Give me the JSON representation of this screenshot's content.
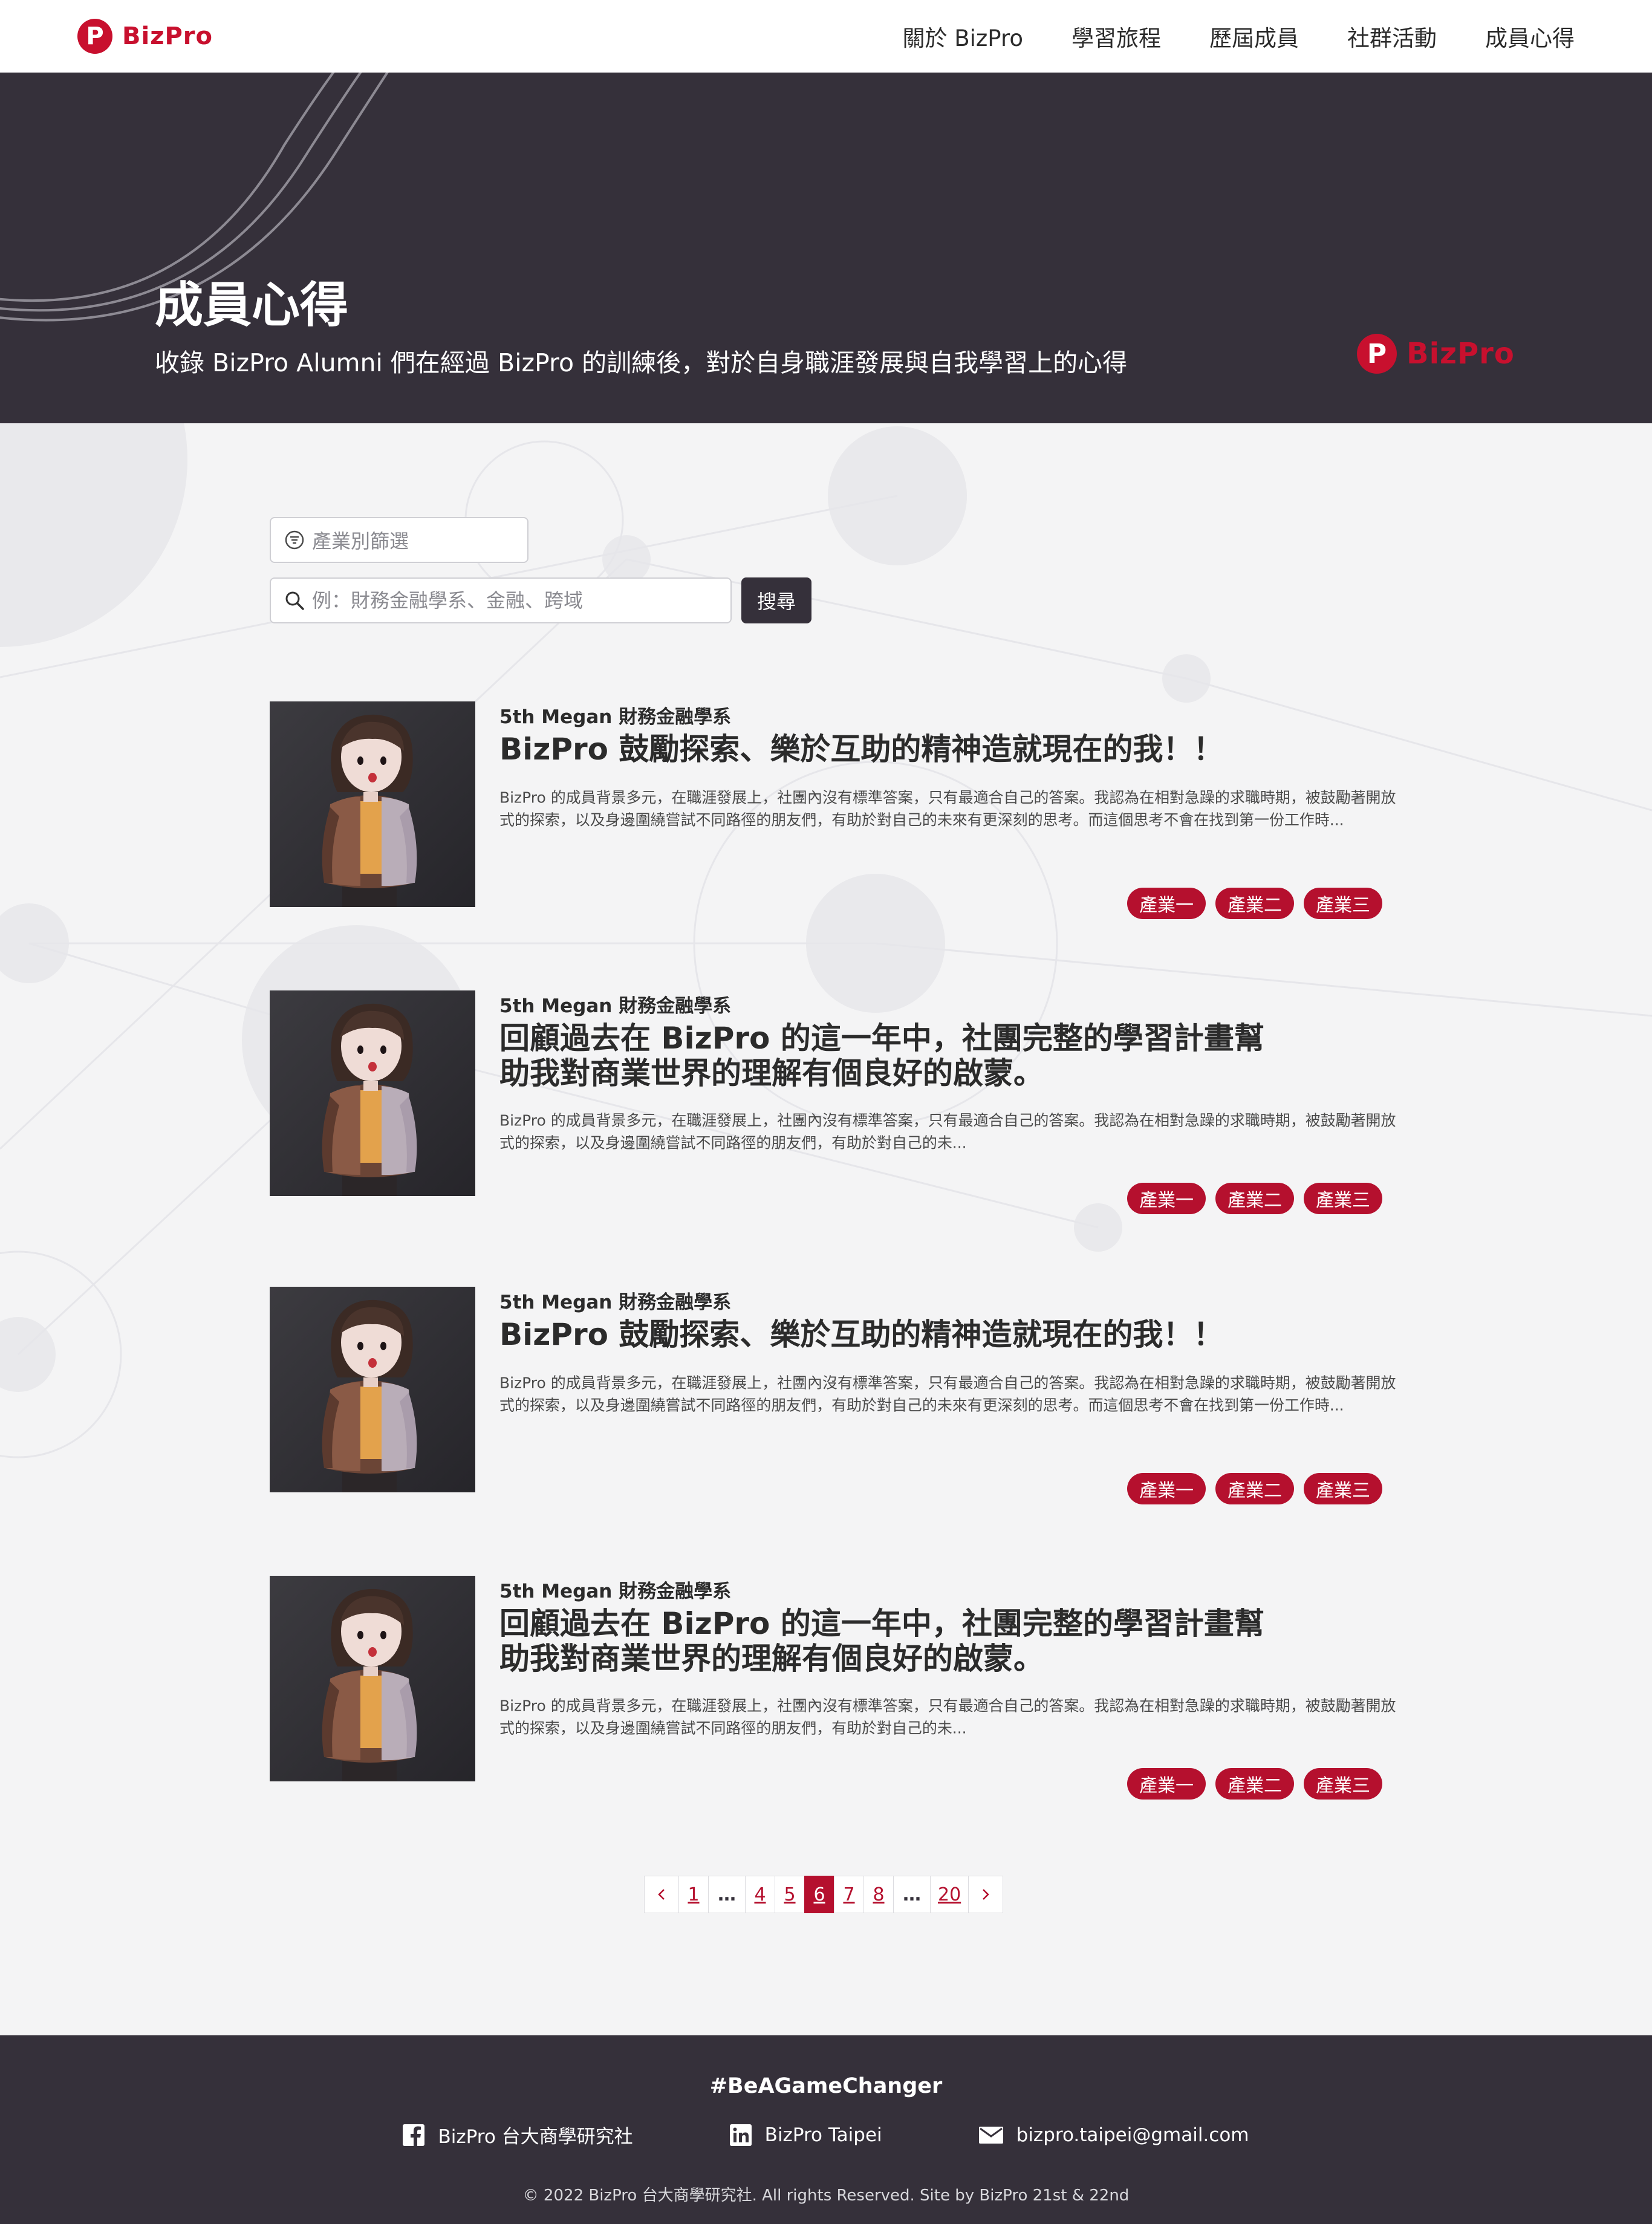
{
  "header": {
    "logo_letter": "P",
    "logo_text": "BizPro",
    "nav": [
      {
        "label": "關於 BizPro"
      },
      {
        "label": "學習旅程"
      },
      {
        "label": "歷屆成員"
      },
      {
        "label": "社群活動"
      },
      {
        "label": "成員心得"
      }
    ]
  },
  "hero": {
    "title": "成員心得",
    "subtitle": "收錄 BizPro Alumni 們在經過 BizPro 的訓練後，對於自身職涯發展與自我學習上的心得",
    "logo_letter": "P",
    "logo_text": "BizPro"
  },
  "filters": {
    "industry_placeholder": "產業別篩選",
    "search_placeholder": "例：財務金融學系、金融、跨域",
    "search_value": "",
    "search_button": "搜尋"
  },
  "articles": [
    {
      "meta": "5th Megan 財務金融學系",
      "title": "BizPro 鼓勵探索、樂於互助的精神造就現在的我！！",
      "excerpt": "BizPro 的成員背景多元，在職涯發展上，社團內沒有標準答案，只有最適合自己的答案。我認為在相對急躁的求職時期，被鼓勵著開放式的探索，以及身邊圍繞嘗試不同路徑的朋友們，有助於對自己的未來有更深刻的思考。而這個思考不會在找到第一份工作時...",
      "tags": [
        "產業一",
        "產業二",
        "產業三"
      ]
    },
    {
      "meta": "5th Megan 財務金融學系",
      "title": "回顧過去在 BizPro 的這一年中，社團完整的學習計畫幫助我對商業世界的理解有個良好的啟蒙。",
      "excerpt": "BizPro 的成員背景多元，在職涯發展上，社團內沒有標準答案，只有最適合自己的答案。我認為在相對急躁的求職時期，被鼓勵著開放式的探索，以及身邊圍繞嘗試不同路徑的朋友們，有助於對自己的未...",
      "tags": [
        "產業一",
        "產業二",
        "產業三"
      ]
    },
    {
      "meta": "5th Megan 財務金融學系",
      "title": "BizPro 鼓勵探索、樂於互助的精神造就現在的我！！",
      "excerpt": "BizPro 的成員背景多元，在職涯發展上，社團內沒有標準答案，只有最適合自己的答案。我認為在相對急躁的求職時期，被鼓勵著開放式的探索，以及身邊圍繞嘗試不同路徑的朋友們，有助於對自己的未來有更深刻的思考。而這個思考不會在找到第一份工作時...",
      "tags": [
        "產業一",
        "產業二",
        "產業三"
      ]
    },
    {
      "meta": "5th Megan 財務金融學系",
      "title": "回顧過去在 BizPro 的這一年中，社團完整的學習計畫幫助我對商業世界的理解有個良好的啟蒙。",
      "excerpt": "BizPro 的成員背景多元，在職涯發展上，社團內沒有標準答案，只有最適合自己的答案。我認為在相對急躁的求職時期，被鼓勵著開放式的探索，以及身邊圍繞嘗試不同路徑的朋友們，有助於對自己的未...",
      "tags": [
        "產業一",
        "產業二",
        "產業三"
      ]
    }
  ],
  "pagination": {
    "prev_icon": "chevron-left-icon",
    "next_icon": "chevron-right-icon",
    "pages": [
      "1",
      "…",
      "4",
      "5",
      "6",
      "7",
      "8",
      "…",
      "20"
    ],
    "current": "6"
  },
  "footer": {
    "tagline": "#BeAGameChanger",
    "facebook": "BizPro 台大商學研究社",
    "linkedin": "BizPro Taipei",
    "email": "bizpro.taipei@gmail.com",
    "copyright": "© 2022 BizPro 台大商學研究社. All rights Reserved. Site by BizPro 21st & 22nd"
  },
  "colors": {
    "brand_red": "#c8102e",
    "tag_red": "#b5102e",
    "dark": "#35303a",
    "page_bg": "#f4f4f5"
  }
}
